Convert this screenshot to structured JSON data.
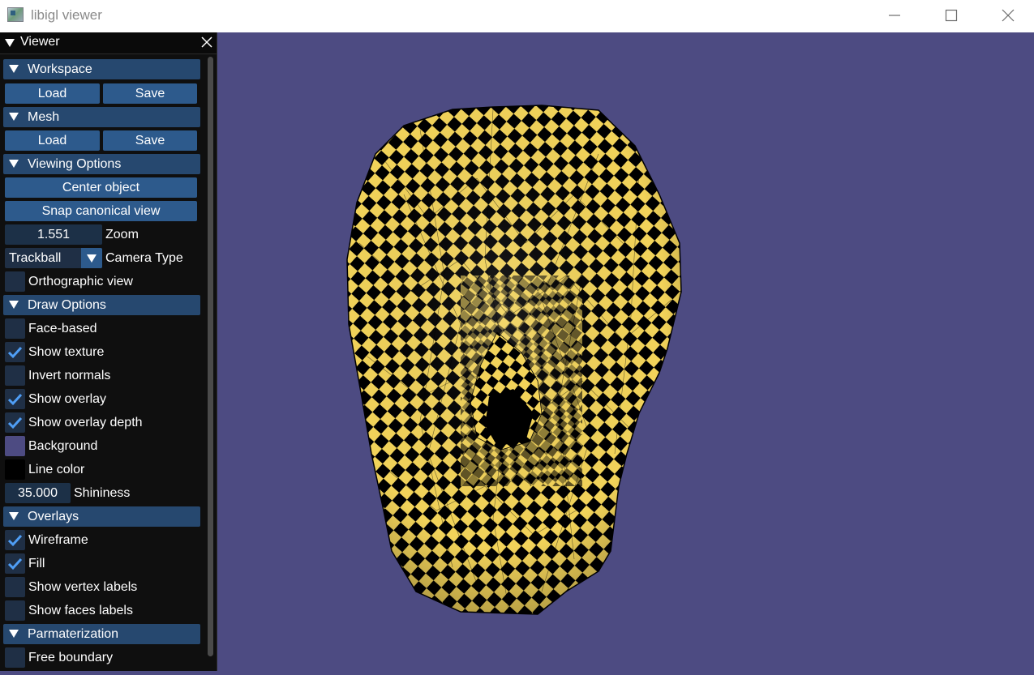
{
  "window": {
    "title": "libigl viewer"
  },
  "panel": {
    "title": "Viewer",
    "workspace": {
      "label": "Workspace",
      "load": "Load",
      "save": "Save"
    },
    "mesh": {
      "label": "Mesh",
      "load": "Load",
      "save": "Save"
    },
    "viewing": {
      "label": "Viewing Options",
      "center": "Center object",
      "snap": "Snap canonical view",
      "zoom_value": "1.551",
      "zoom_label": "Zoom",
      "camera_value": "Trackball",
      "camera_label": "Camera Type",
      "ortho_label": "Orthographic view"
    },
    "draw": {
      "label": "Draw Options",
      "face_based": "Face-based",
      "show_texture": "Show texture",
      "invert_normals": "Invert normals",
      "show_overlay": "Show overlay",
      "show_overlay_depth": "Show overlay depth",
      "background": "Background",
      "line_color": "Line color",
      "shininess_value": "35.000",
      "shininess_label": "Shininess"
    },
    "overlays": {
      "label": "Overlays",
      "wireframe": "Wireframe",
      "fill": "Fill",
      "vertex_labels": "Show vertex labels",
      "faces_labels": "Show faces labels"
    },
    "param": {
      "label": "Parmaterization",
      "free_boundary": "Free boundary"
    }
  },
  "state": {
    "orthographic": false,
    "face_based": false,
    "show_texture": true,
    "invert_normals": false,
    "show_overlay": true,
    "show_overlay_depth": true,
    "wireframe": true,
    "fill": true,
    "vertex_labels": false,
    "faces_labels": false,
    "free_boundary": false
  },
  "colors": {
    "background": "#4d4b82",
    "line_color": "#000000",
    "texture_light": "#f2d35a",
    "texture_dark": "#000000",
    "header": "#26486f",
    "button": "#2d5a8c",
    "check": "#4f9ef5"
  }
}
